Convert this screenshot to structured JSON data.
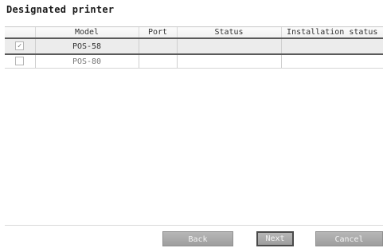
{
  "page": {
    "title": "Designated printer"
  },
  "table": {
    "headers": {
      "check": "",
      "model": "Model",
      "port": "Port",
      "status": "Status",
      "install": "Installation status"
    },
    "rows": [
      {
        "check": "✓",
        "model": "POS-58",
        "port": "",
        "status": "",
        "install": "",
        "checked": true,
        "selected": true
      },
      {
        "check": "",
        "model": "POS-80",
        "port": "",
        "status": "",
        "install": "",
        "checked": false,
        "selected": false
      }
    ]
  },
  "buttons": {
    "back": "Back",
    "next": "Next",
    "cancel": "Cancel"
  }
}
